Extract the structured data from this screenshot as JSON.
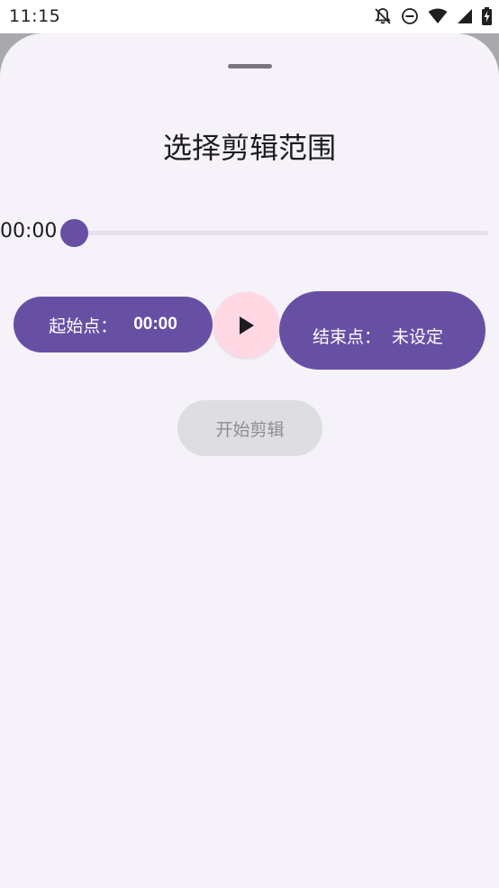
{
  "status_bar": {
    "time": "11:15",
    "icons": [
      "notifications-off-icon",
      "do-not-disturb-icon",
      "wifi-icon",
      "signal-icon",
      "battery-charging-icon"
    ]
  },
  "sheet": {
    "title": "选择剪辑范围",
    "current_time": "00:00",
    "slider_position_fraction": 0.0,
    "start_point": {
      "label": "起始点：",
      "value": "00:00"
    },
    "play_icon": "play-icon",
    "end_point": {
      "label": "结束点：",
      "value": "未设定"
    },
    "begin_button_label": "开始剪辑"
  },
  "colors": {
    "primary": "#6750a4",
    "play_container": "#ffd8e4",
    "sheet_background": "#f6f2f9",
    "disabled_button": "#dedde2"
  }
}
